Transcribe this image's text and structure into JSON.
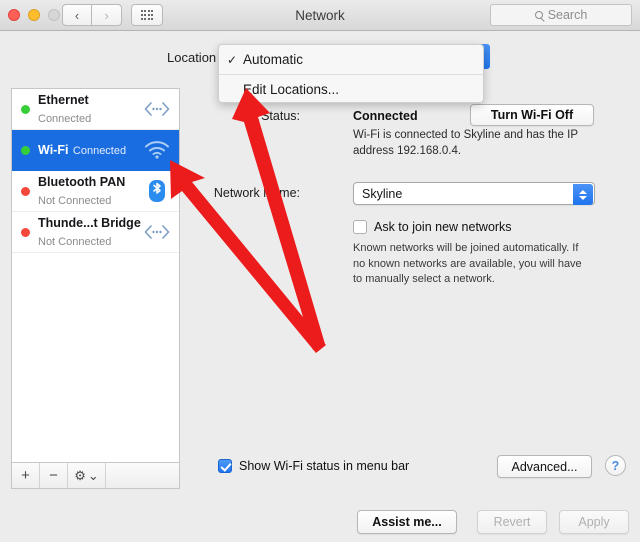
{
  "window": {
    "title": "Network",
    "traffic_lights": [
      "close",
      "minimize",
      "zoom"
    ],
    "nav_back": "‹",
    "nav_forward": "›",
    "grid_icon": "grid-icon",
    "search_placeholder": "Search"
  },
  "location": {
    "label": "Location",
    "selected": "Automatic",
    "menu_items": [
      {
        "label": "Automatic",
        "checked": true
      },
      {
        "label": "Edit Locations...",
        "checked": false
      }
    ],
    "check_glyph": "✓"
  },
  "sidebar": {
    "services": [
      {
        "name": "Ethernet",
        "status": "Connected",
        "dot": "green",
        "icon": "ethernet-icon",
        "selected": false
      },
      {
        "name": "Wi-Fi",
        "status": "Connected",
        "dot": "green",
        "icon": "wifi-icon",
        "selected": true
      },
      {
        "name": "Bluetooth PAN",
        "status": "Not Connected",
        "dot": "red",
        "icon": "bluetooth-icon",
        "selected": false
      },
      {
        "name": "Thunde...t Bridge",
        "status": "Not Connected",
        "dot": "red",
        "icon": "ethernet-icon",
        "selected": false
      }
    ],
    "toolbar": {
      "add": "+",
      "remove": "−",
      "gear": "⚙",
      "gear_chevron": "⌄"
    }
  },
  "detail": {
    "status_label": "Status:",
    "status_value": "Connected",
    "status_description": "Wi-Fi is connected to Skyline and has the IP address 192.168.0.4.",
    "toggle_button": "Turn Wi-Fi Off",
    "network_name_label": "Network Name:",
    "network_name_value": "Skyline",
    "ask_join_label": "Ask to join new networks",
    "ask_join_checked": false,
    "ask_join_description": "Known networks will be joined automatically. If no known networks are available, you will have to manually select a network.",
    "show_status_label": "Show Wi-Fi status in menu bar",
    "show_status_checked": true,
    "advanced_button": "Advanced...",
    "help_button": "?"
  },
  "footer": {
    "assist": "Assist me...",
    "revert": "Revert",
    "apply": "Apply"
  },
  "colors": {
    "selection_blue": "#1a6de0",
    "accent_blue": "#2176ee",
    "status_connected": "#37cf39",
    "status_disconnected": "#f4483b",
    "annotation_red": "#ec1c1c"
  }
}
